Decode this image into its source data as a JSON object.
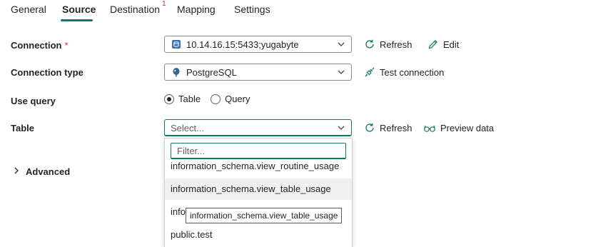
{
  "tabs": [
    {
      "label": "General"
    },
    {
      "label": "Source"
    },
    {
      "label": "Destination",
      "badge": "1"
    },
    {
      "label": "Mapping"
    },
    {
      "label": "Settings"
    }
  ],
  "active_tab": "Source",
  "connection": {
    "label": "Connection",
    "required_mark": "*",
    "value": "10.14.16.15:5433;yugabyte",
    "refresh_label": "Refresh",
    "edit_label": "Edit"
  },
  "connection_type": {
    "label": "Connection type",
    "value": "PostgreSQL",
    "test_label": "Test connection"
  },
  "use_query": {
    "label": "Use query",
    "options": [
      {
        "label": "Table",
        "selected": true
      },
      {
        "label": "Query",
        "selected": false
      }
    ]
  },
  "table": {
    "label": "Table",
    "placeholder": "Select...",
    "refresh_label": "Refresh",
    "preview_label": "Preview data"
  },
  "advanced": {
    "label": "Advanced"
  },
  "dropdown": {
    "filter_placeholder": "Filter...",
    "items": [
      {
        "label": "information_schema.view_routine_usage"
      },
      {
        "label": "information_schema.view_table_usage"
      },
      {
        "label": "info"
      },
      {
        "label": "public.test"
      }
    ],
    "tooltip": "information_schema.view_table_usage"
  },
  "colors": {
    "accent": "#117865",
    "required": "#c4314b"
  }
}
